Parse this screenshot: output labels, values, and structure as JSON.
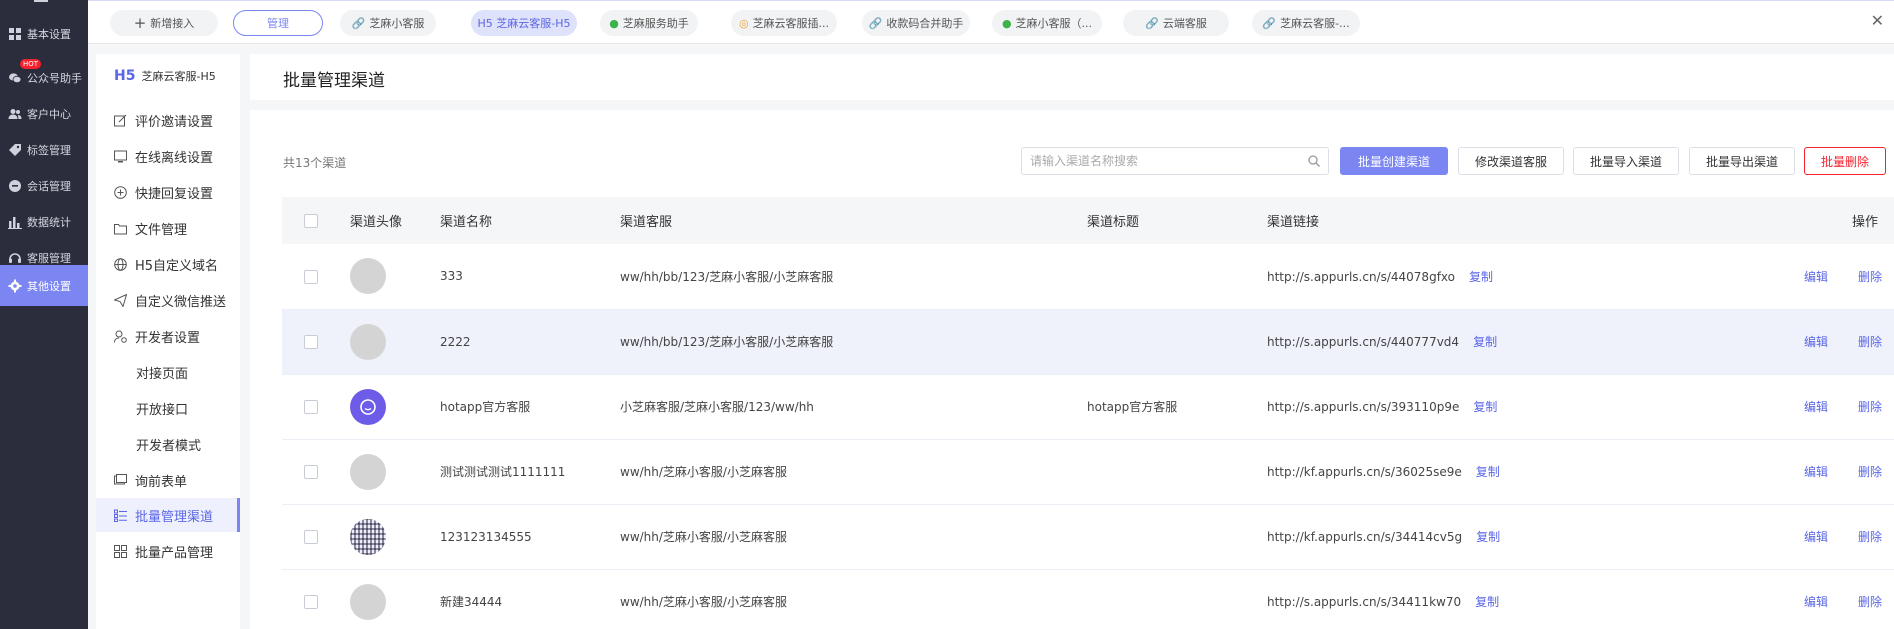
{
  "left_nav": {
    "items": [
      {
        "label": "基本设置",
        "icon": "grid-icon"
      },
      {
        "label": "公众号助手",
        "icon": "wechat-icon",
        "badge": "HOT"
      },
      {
        "label": "客户中心",
        "icon": "users-icon"
      },
      {
        "label": "标签管理",
        "icon": "tag-icon"
      },
      {
        "label": "会话管理",
        "icon": "chat-icon"
      },
      {
        "label": "数据统计",
        "icon": "bar-chart-icon"
      },
      {
        "label": "客服管理",
        "icon": "headset-icon"
      },
      {
        "label": "其他设置",
        "icon": "gear-icon"
      }
    ]
  },
  "topbar": {
    "add_label": "新增接入",
    "manage_label": "管理",
    "tabs": [
      {
        "label": "芝麻小客服",
        "icon": "link-icon"
      },
      {
        "label": "H5 芝麻云客服-H5",
        "icon": "h5-icon"
      },
      {
        "label": "芝麻服务助手",
        "icon": "wechat-icon"
      },
      {
        "label": "芝麻云客服插...",
        "icon": "plugin-icon"
      },
      {
        "label": "收款码合并助手",
        "icon": "link-icon"
      },
      {
        "label": "芝麻小客服（...",
        "icon": "wechat-icon"
      },
      {
        "label": "云端客服",
        "icon": "link-icon"
      },
      {
        "label": "芝麻云客服-...",
        "icon": "link-icon"
      }
    ]
  },
  "sidebar": {
    "badge": "H5",
    "title": "芝麻云客服-H5",
    "items": [
      {
        "label": "评价邀请设置",
        "icon": "edit-icon"
      },
      {
        "label": "在线离线设置",
        "icon": "monitor-icon"
      },
      {
        "label": "快捷回复设置",
        "icon": "plus-circle-icon"
      },
      {
        "label": "文件管理",
        "icon": "folder-icon"
      },
      {
        "label": "H5自定义域名",
        "icon": "globe-icon"
      },
      {
        "label": "自定义微信推送",
        "icon": "send-icon"
      },
      {
        "label": "开发者设置",
        "icon": "developer-icon"
      },
      {
        "label": "对接页面",
        "icon": ""
      },
      {
        "label": "开放接口",
        "icon": ""
      },
      {
        "label": "开发者模式",
        "icon": ""
      },
      {
        "label": "询前表单",
        "icon": "form-icon"
      },
      {
        "label": "批量管理渠道",
        "icon": "list-icon"
      },
      {
        "label": "批量产品管理",
        "icon": "apps-icon"
      }
    ]
  },
  "main": {
    "title": "批量管理渠道",
    "count_text": "共13个渠道",
    "search_placeholder": "请输入渠道名称搜索",
    "buttons": {
      "create": "批量创建渠道",
      "modify": "修改渠道客服",
      "import": "批量导入渠道",
      "export": "批量导出渠道",
      "delete": "批量删除"
    },
    "columns": [
      "渠道头像",
      "渠道名称",
      "渠道客服",
      "渠道标题",
      "渠道链接",
      "操作"
    ],
    "copy_label": "复制",
    "edit_label": "编辑",
    "delete_label": "删除",
    "rows": [
      {
        "name": "333",
        "service": "ww/hh/bb/123/芝麻小客服/小芝麻客服",
        "title": "",
        "link": "http://s.appurls.cn/s/44078gfxo",
        "avatar": "gray"
      },
      {
        "name": "2222",
        "service": "ww/hh/bb/123/芝麻小客服/小芝麻客服",
        "title": "",
        "link": "http://s.appurls.cn/s/440777vd4",
        "avatar": "gray"
      },
      {
        "name": "hotapp官方客服",
        "service": "小芝麻客服/芝麻小客服/123/ww/hh",
        "title": "hotapp官方客服",
        "link": "http://s.appurls.cn/s/393110p9e",
        "avatar": "purple"
      },
      {
        "name": "测试测试测试1111111",
        "service": "ww/hh/芝麻小客服/小芝麻客服",
        "title": "",
        "link": "http://kf.appurls.cn/s/36025se9e",
        "avatar": "gray"
      },
      {
        "name": "123123134555",
        "service": "ww/hh/芝麻小客服/小芝麻客服",
        "title": "",
        "link": "http://kf.appurls.cn/s/34414cv5g",
        "avatar": "qr"
      },
      {
        "name": "新建34444",
        "service": "ww/hh/芝麻小客服/小芝麻客服",
        "title": "",
        "link": "http://s.appurls.cn/s/34411kw70",
        "avatar": "gray"
      }
    ]
  }
}
